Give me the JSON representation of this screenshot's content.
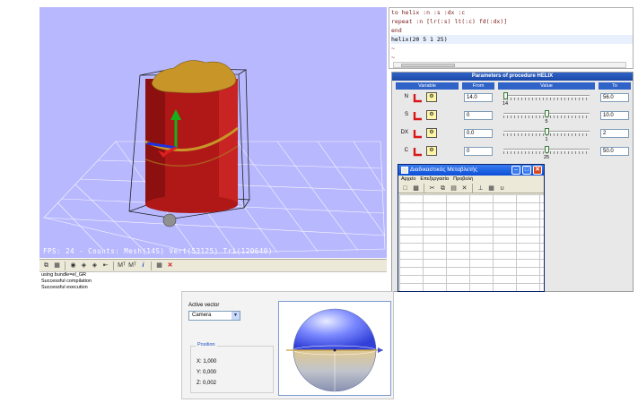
{
  "viewport": {
    "stats": "FPS: 24 - Counts: Mesh(14S) Vert(53125) Tri(120640)"
  },
  "toolbar": {
    "icons": [
      "copy-icon",
      "save-icon",
      "binoculars-icon",
      "find-next-icon",
      "find-prev-icon",
      "import-icon",
      "m-axis-icon",
      "m-axis-alt-icon",
      "info-icon",
      "grid-icon",
      "close-icon"
    ],
    "m1": "Mᵀ",
    "m2": "Mᵀ",
    "info": "i"
  },
  "console": {
    "lines": [
      "using bundle=el_GR",
      "Successful compilation",
      "Successful execution"
    ]
  },
  "editor": {
    "lines": [
      "to helix :n :s :dx :c",
      "repeat :n [lr(:s) lt(:c) fd(:dx)]",
      "end",
      "helix(20 5 1 25)",
      "~",
      "~"
    ]
  },
  "params": {
    "title": "Parameters of procedure HELIX",
    "headers": {
      "variable": "Variable",
      "from": "From",
      "value": "Value",
      "to": "To"
    },
    "rows": [
      {
        "name": "N",
        "from": "14.0",
        "value": "20",
        "to": "56.0",
        "thumb_fraction": 0.0,
        "below": "14"
      },
      {
        "name": "S",
        "from": "0",
        "value": "5",
        "to": "10.0",
        "thumb_fraction": 0.5,
        "below": "5"
      },
      {
        "name": "DX",
        "from": "0.0",
        "value": "1",
        "to": "2",
        "thumb_fraction": 0.5,
        "below": "1"
      },
      {
        "name": "C",
        "from": "0",
        "value": "25",
        "to": "50.0",
        "thumb_fraction": 0.5,
        "below": "25"
      }
    ]
  },
  "greek_window": {
    "title": "Διαδικαστικός Μεταβλετής",
    "menu": [
      "Αρχείο",
      "Επεξεργασία",
      "Προβολή"
    ]
  },
  "active_vector": {
    "label": "Active vector",
    "selected": "Camera",
    "position_legend": "Position",
    "x": "X: 1,000",
    "y": "Y: 0,000",
    "z": "Z: 0,002"
  },
  "colors": {
    "viewport_bg": "#b8b8ff",
    "cylinder": "#b01818",
    "lid": "#c89628",
    "titlebar_blue": "#2f63c8"
  }
}
